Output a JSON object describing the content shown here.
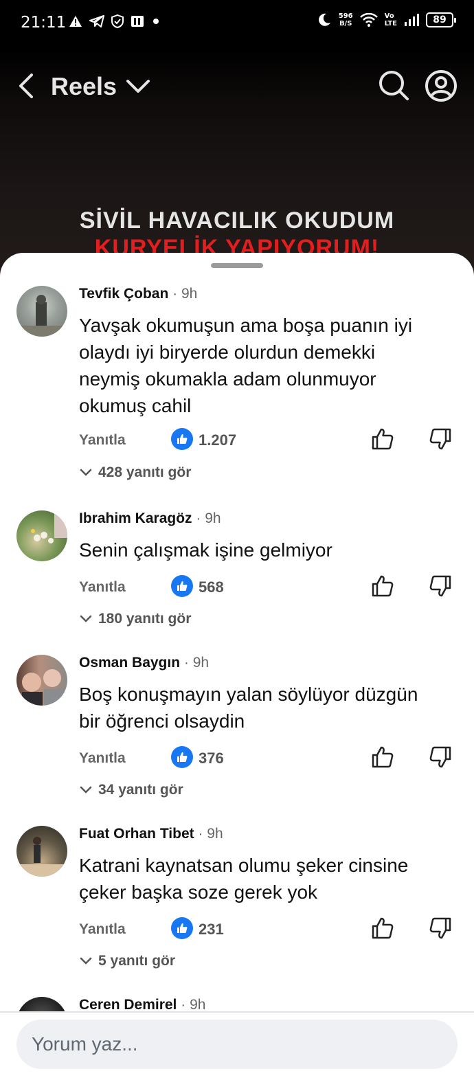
{
  "status_bar": {
    "time": "21:11",
    "net_speed_value": "596",
    "net_speed_unit": "B/S",
    "volte_top": "Vo",
    "volte_bottom": "LTE",
    "battery": "89",
    "icons": [
      "alert-icon",
      "telegram-icon",
      "shield-icon",
      "app-icon",
      "dot-icon",
      "moon-icon",
      "wifi-icon",
      "signal-icon",
      "battery-icon"
    ]
  },
  "header": {
    "title": "Reels"
  },
  "video": {
    "title": "SİVİL HAVACILIK OKUDUM",
    "subtitle": "KURYELİK YAPIYORUM!"
  },
  "colors": {
    "accent": "#1877f2",
    "subtitle_red": "#e41e1e"
  },
  "comments": [
    {
      "author": "Tevfik Çoban",
      "time": "· 9h",
      "lines": [
        "Yavşak okumuşun ama boşa puanın iyi",
        "olaydı iyi biryerde olurdun demekki",
        "neymiş okumakla adam olunmuyor",
        "okumuş cahil"
      ],
      "reply_label": "Yanıtla",
      "likes": "1.207",
      "replies_label": "428 yanıtı gör"
    },
    {
      "author": "Ibrahim Karagöz",
      "time": "· 9h",
      "lines": [
        "Senin çalışmak işine gelmiyor"
      ],
      "reply_label": "Yanıtla",
      "likes": "568",
      "replies_label": "180 yanıtı gör"
    },
    {
      "author": "Osman Baygın",
      "time": "· 9h",
      "lines": [
        "Boş konuşmayın yalan söylüyor düzgün",
        "bir öğrenci olsaydin"
      ],
      "reply_label": "Yanıtla",
      "likes": "376",
      "replies_label": "34 yanıtı gör"
    },
    {
      "author": "Fuat Orhan Tibet",
      "time": "· 9h",
      "lines": [
        "Katrani kaynatsan olumu şeker cinsine",
        "çeker başka soze gerek yok"
      ],
      "reply_label": "Yanıtla",
      "likes": "231",
      "replies_label": "5 yanıtı gör"
    },
    {
      "author": "Ceren Demirel",
      "time": "· 9h"
    }
  ],
  "composer": {
    "placeholder": "Yorum yaz..."
  }
}
